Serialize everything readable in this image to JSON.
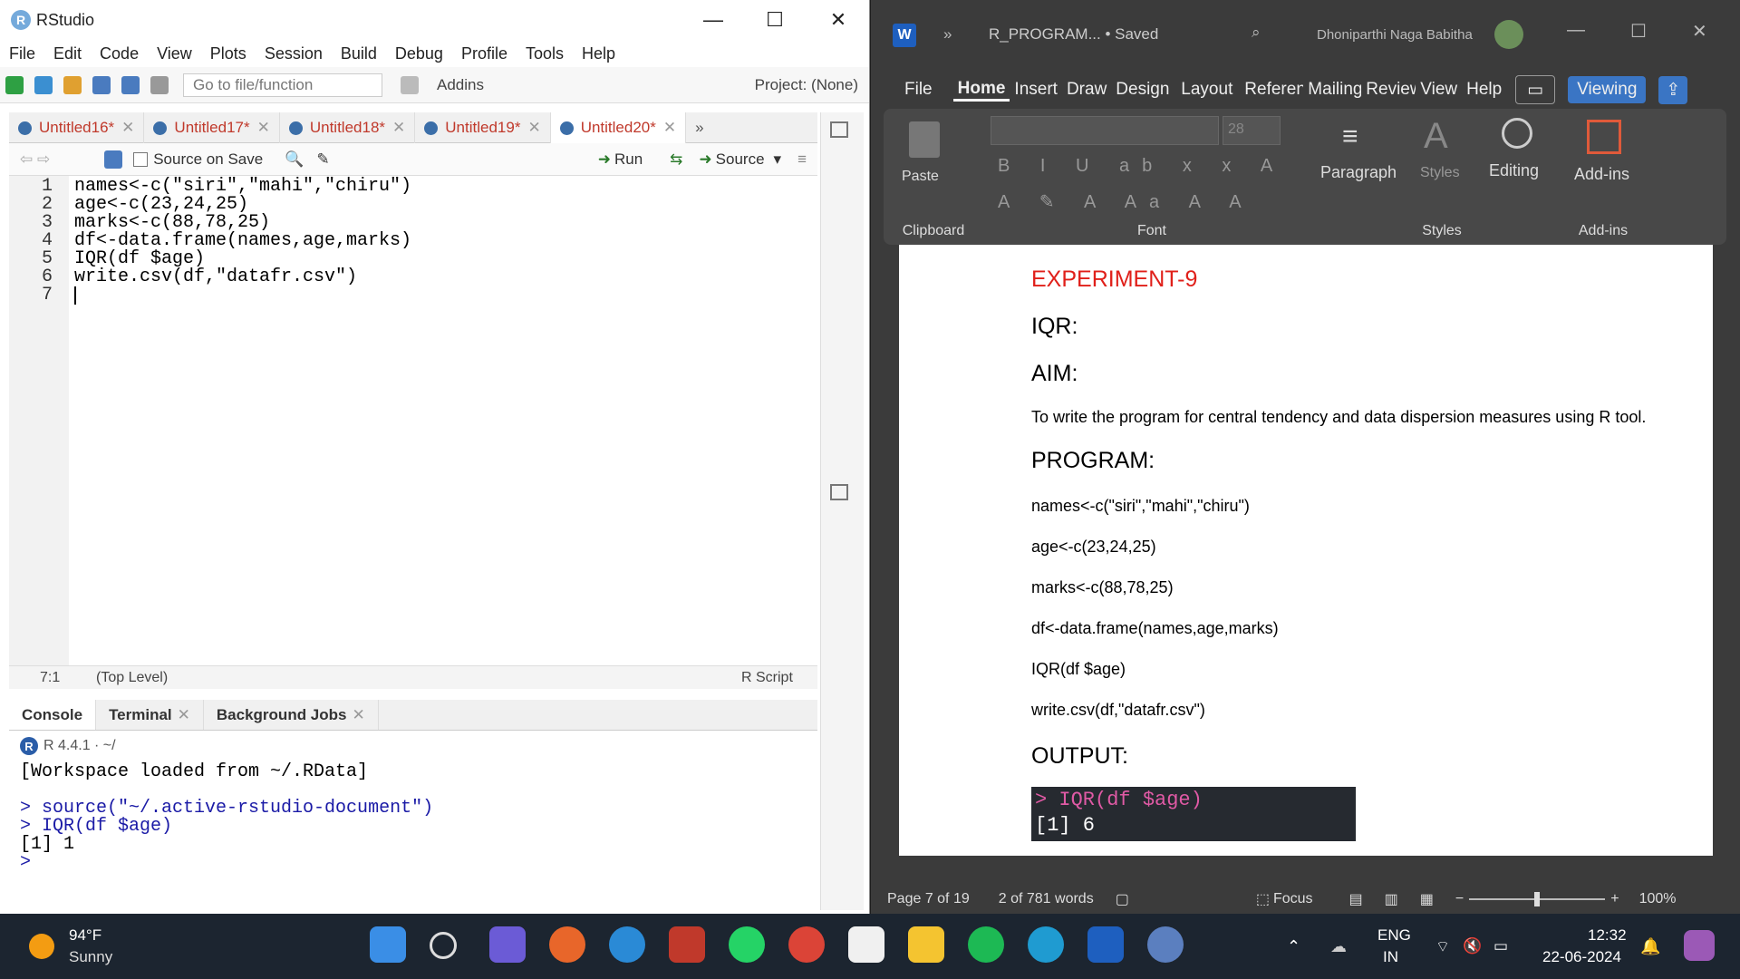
{
  "rstudio": {
    "title": "RStudio",
    "menu": [
      "File",
      "Edit",
      "Code",
      "View",
      "Plots",
      "Session",
      "Build",
      "Debug",
      "Profile",
      "Tools",
      "Help"
    ],
    "toolbar": {
      "goto_placeholder": "Go to file/function",
      "addins": "Addins",
      "project": "Project: (None)"
    },
    "editor_tabs": [
      "Untitled16*",
      "Untitled17*",
      "Untitled18*",
      "Untitled19*",
      "Untitled20*"
    ],
    "editor_toolbar": {
      "source_on_save": "Source on Save",
      "run": "Run",
      "source": "Source"
    },
    "line_numbers": [
      "1",
      "2",
      "3",
      "4",
      "5",
      "6",
      "7"
    ],
    "status": {
      "position": "7:1",
      "scope": "(Top Level)",
      "filetype": "R Script"
    },
    "console_tabs": [
      "Console",
      "Terminal",
      "Background Jobs"
    ],
    "console_version": "R 4.4.1 · ~/",
    "console_lines": [
      "[Workspace loaded from ~/.RData]",
      "",
      "> source(\"~/.active-rstudio-document\")",
      "> IQR(df $age)",
      "[1] 1",
      "> "
    ]
  },
  "word": {
    "title": "R_PROGRAM... • Saved",
    "user": "Dhoniparthi Naga Babitha",
    "tabs": [
      "File",
      "Home",
      "Insert",
      "Draw",
      "Design",
      "Layout",
      "References",
      "Mailings",
      "Review",
      "View",
      "Help"
    ],
    "viewing": "Viewing",
    "ribbon": {
      "paste": "Paste",
      "clipboard": "Clipboard",
      "font": "Font",
      "font_size": "28",
      "paragraph": "Paragraph",
      "styles": "Styles",
      "styles_group": "Styles",
      "editing": "Editing",
      "addins": "Add-ins",
      "addins_group": "Add-ins"
    },
    "doc": {
      "experiment": "EXPERIMENT-9",
      "iqr": "IQR:",
      "aim": "AIM:",
      "aim_text": "To write the program for central tendency and data dispersion measures using R tool.",
      "program": "PROGRAM:",
      "code": [
        "names<-c(\"siri\",\"mahi\",\"chiru\")",
        "age<-c(23,24,25)",
        "marks<-c(88,78,25)",
        "df<-data.frame(names,age,marks)",
        "IQR(df $age)",
        "write.csv(df,\"datafr.csv\")"
      ],
      "output": "OUTPUT:",
      "out_line1": "> IQR(df $age)",
      "out_line2": "[1] 6"
    },
    "status": {
      "page": "Page 7 of 19",
      "words": "2 of 781 words",
      "focus": "Focus",
      "zoom": "100%"
    }
  },
  "taskbar": {
    "weather_temp": "94°F",
    "weather_desc": "Sunny",
    "lang1": "ENG",
    "lang2": "IN",
    "time": "12:32",
    "date": "22-06-2024"
  }
}
